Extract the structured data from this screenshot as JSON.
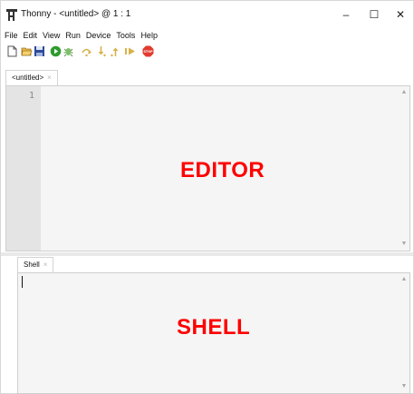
{
  "window": {
    "title": "Thonny  -  <untitled>  @  1 : 1",
    "minimize": "–",
    "maximize": "☐",
    "close": "✕"
  },
  "menu": [
    "File",
    "Edit",
    "View",
    "Run",
    "Device",
    "Tools",
    "Help"
  ],
  "toolbar": {
    "icons": [
      "new-file",
      "open-file",
      "save",
      "run",
      "debug",
      "step-over",
      "step-into",
      "step-out",
      "resume",
      "stop"
    ],
    "stop_label": "STOP"
  },
  "editor": {
    "tab_label": "<untitled>",
    "tab_close": "×",
    "line_numbers": [
      "1"
    ],
    "overlay_label": "EDITOR"
  },
  "shell": {
    "tab_label": "Shell",
    "tab_close": "×",
    "overlay_label": "SHELL"
  },
  "scroll": {
    "up": "▲",
    "down": "▼"
  },
  "colors": {
    "overlay": "#ff0000",
    "gutter": "#e4e4e4",
    "editor_bg": "#f5f5f5",
    "run_green": "#2e9a2e",
    "stop_red": "#e23b2e"
  }
}
